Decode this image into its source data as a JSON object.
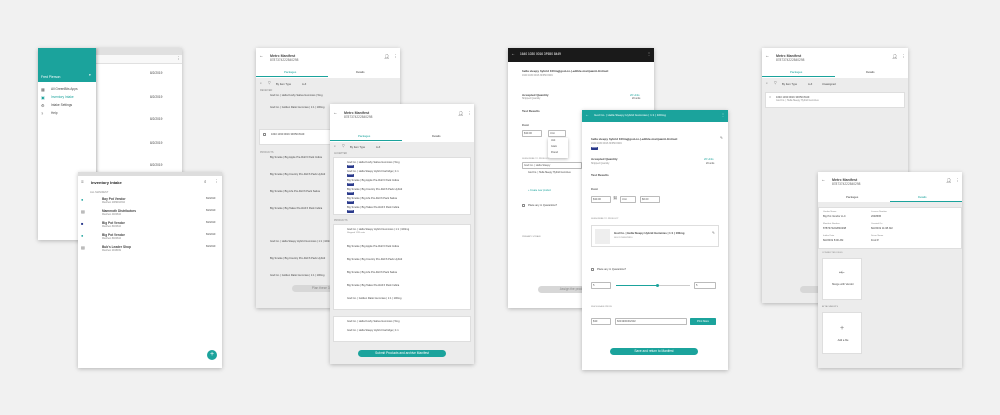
{
  "colors": {
    "accent": "#1ba39c",
    "dark": "#1a1a1a",
    "chip": "#2a3a8c"
  },
  "drawer": {
    "user": "Fred Pierson",
    "items": [
      "All GreenBits Apps",
      "Inventory Intake",
      "Intake Settings",
      "Help"
    ]
  },
  "intake": {
    "title": "Inventory Intake",
    "section": "ALL MANIFEST",
    "rows": [
      {
        "name": "Bay Pot Vendor",
        "sub": "Manifest 2089494394",
        "date": "8/2/2019"
      },
      {
        "name": "Mammoth Distributors",
        "sub": "Manifest 4484844",
        "date": "8/2/2019"
      },
      {
        "name": "Big Pot Vendor",
        "sub": "Manifest 8484844",
        "date": "8/2/2019"
      },
      {
        "name": "Big Pot Vendor",
        "sub": "Manifest 8484844",
        "date": "8/2/2019"
      },
      {
        "name": "Bub's Leader Shop",
        "sub": "Manifest 2948499",
        "date": "8/2/2019"
      }
    ],
    "fab": "+"
  },
  "manifest": {
    "title": "Metrc Manifest",
    "number": "8787374222840298",
    "tabs": [
      "Packages",
      "Details"
    ],
    "filter_label": "By Item Type",
    "sort": "A-Z",
    "sort_unassigned": "Unassigned",
    "received": "RECEIVED",
    "accepted": "ACCEPTED",
    "products": "PRODUCTS",
    "items1": [
      "God Co. | Hella Kushy Sativa Gummies | 5mg",
      "God Co. | Golden Ratio Gummies | 1:1 | 100mg",
      "1640 1030 0016 3F650 8449"
    ],
    "items2": [
      "Big Smoke | Big Apple Pre-Roll 6 Pack Indica",
      "Big Smoke | Big Country Pre-Roll 6 Pack Hybrid",
      "Big Smoke | Big Life Pre-Roll 6 Pack Sativa",
      "Big Smoke | Big Takes Pre-Roll 6 Pack Indica"
    ],
    "items3": [
      "God Co. | Hella Sleepy Hybrid Gummies | 1:1 | 100mg",
      "Big Smoke | Big Country Pre-Roll 6 Pack Hybrid",
      "God Co. | Golden Ratio Gummies | 1:1 | 100mg"
    ],
    "items4": [
      "God Co. | Hella Kushy Sativa Gummies | 5mg",
      "God Co. | Hella Sleepy Hybrid Cartridge | 1:1",
      "Big Smoke | Big Apple Pre-Roll 6 Pack Indica",
      "Big Smoke | Big Country Pre-Roll 6 Pack Hybrid",
      "Big Smoke | Big Life Pre-Roll 6 Pack Sativa",
      "Big Smoke | Big Takes Pre-Roll 6 Pack Indica"
    ],
    "items5": [
      "God Co. | Hella Kushy Sativa Gummies | 5mg",
      "God Co. | Hella Sleepy Hybrid Cartridge | 1:1"
    ],
    "meta": "Shipped 1/28 units",
    "tag": "Shake",
    "submit_faded": "Plan these 3 manifests",
    "submit": "Submit Products and archive Manifest"
  },
  "package": {
    "header": "1640 1030 0016 3F650 8449",
    "name": "hella sleepy hybrid 100mg|god-co.|-edible-marijuanA-Extract",
    "id_line": "1640 1030 0016 3F650 8449",
    "accepted_label": "Accepted Quantity",
    "accepted_value": "20 Units",
    "shipped_label": "Shipped Quantity",
    "shipped_value": "20 units",
    "test_label": "Test Results",
    "cost_label": "Cost",
    "cost_value": "$30.00",
    "unit": "Unit",
    "dropdown": [
      "Unit",
      "Gram",
      "Pound"
    ],
    "assign_label": "SUBSCRIBE TO PRODUCT",
    "assign_items": [
      "God Co. | Hella Sleepy Hybrid Gummies",
      "God Co. | Hella Sleepy"
    ],
    "create": "+ Create new product",
    "quarantine": "Place any in Quarantine?",
    "strain": "PRIMARY STRAIN",
    "accept_faded": "Assign the product",
    "card_title": "God Co. | Hella Sleepy Hybrid Gummies | 1:1 | 100mg",
    "card_sub": "SKU 12345678910",
    "quarantine_qty": "5",
    "price_label": "WHOLESALE PRICE",
    "price_value": "$30",
    "barcode_value": "8231900302332",
    "print": "Print More",
    "save": "Save and return to Manifest",
    "cost_a": "$30.00",
    "cost_b": "$6.00"
  },
  "manifest_b": {
    "item": "1640 1030 0016 3F650 8449",
    "item_sub": "God Co. | Hella Sleepy Hybrid Gummies",
    "details_labels": [
      "Vendor Name",
      "License Number",
      "Manifest Number",
      "Created On",
      "Intake Date",
      "Driver Name"
    ],
    "details_values": [
      "Big Pot Vendor LLC",
      "2048695",
      "8787374222840298",
      "8/2/2019 11:08 AM",
      "8/2/2019 8:00 AM",
      "Fred P."
    ],
    "section_a": "CONNECTED FILES",
    "merge": "Merge with Vendor",
    "section_b": "ATTACHMENTS",
    "add_file": "Add a file"
  }
}
